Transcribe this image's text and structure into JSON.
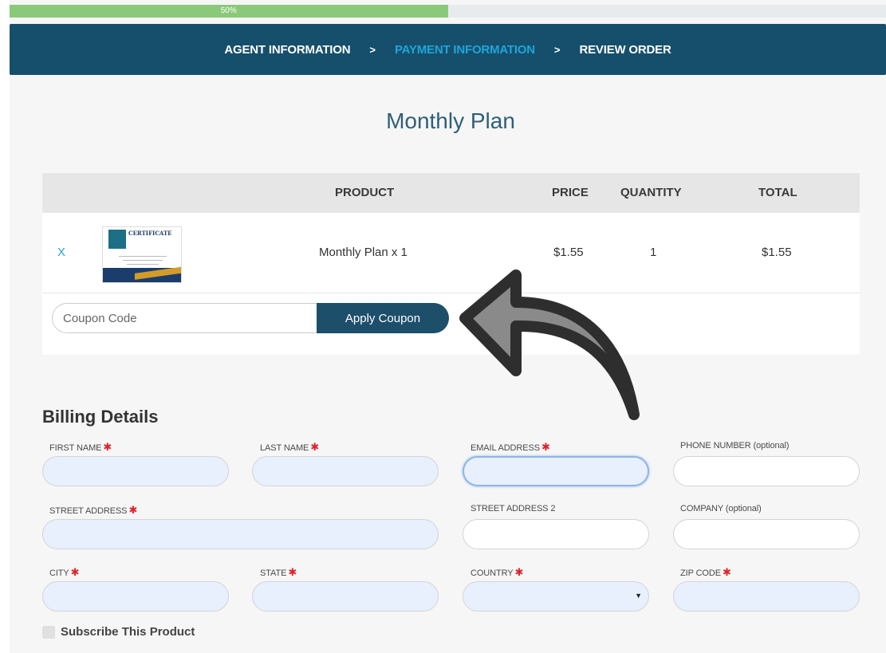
{
  "progress": {
    "percent_label": "50%",
    "value": 0.5
  },
  "steps": [
    {
      "label": "AGENT INFORMATION",
      "active": false
    },
    {
      "label": "PAYMENT INFORMATION",
      "active": true
    },
    {
      "label": "REVIEW ORDER",
      "active": false
    }
  ],
  "step_separator": ">",
  "plan_title": "Monthly Plan",
  "cart": {
    "headers": {
      "product": "PRODUCT",
      "price": "PRICE",
      "quantity": "QUANTITY",
      "total": "TOTAL"
    },
    "rows": [
      {
        "remove": "X",
        "thumb_title": "CERTIFICATE",
        "product": "Monthly Plan x 1",
        "price": "$1.55",
        "quantity": "1",
        "total": "$1.55"
      }
    ],
    "coupon_placeholder": "Coupon Code",
    "apply_label": "Apply Coupon"
  },
  "billing": {
    "title": "Billing Details",
    "fields": {
      "first_name": {
        "label": "FIRST NAME",
        "required": true
      },
      "last_name": {
        "label": "LAST NAME",
        "required": true
      },
      "email": {
        "label": "EMAIL ADDRESS",
        "required": true
      },
      "phone": {
        "label": "PHONE NUMBER (optional)",
        "required": false
      },
      "street": {
        "label": "STREET ADDRESS",
        "required": true
      },
      "street2": {
        "label": "STREET ADDRESS 2",
        "required": false
      },
      "company": {
        "label": "COMPANY (optional)",
        "required": false
      },
      "city": {
        "label": "CITY",
        "required": true
      },
      "state": {
        "label": "STATE",
        "required": true
      },
      "country": {
        "label": "COUNTRY",
        "required": true
      },
      "zip": {
        "label": "ZIP CODE",
        "required": true
      }
    },
    "required_mark": "✱",
    "subscribe_label": "Subscribe This Product"
  },
  "colors": {
    "header_bg": "#164f6c",
    "active_step": "#1ea6d8",
    "progress": "#8bc97a",
    "button": "#1d4f6b",
    "required": "#e0222a"
  }
}
